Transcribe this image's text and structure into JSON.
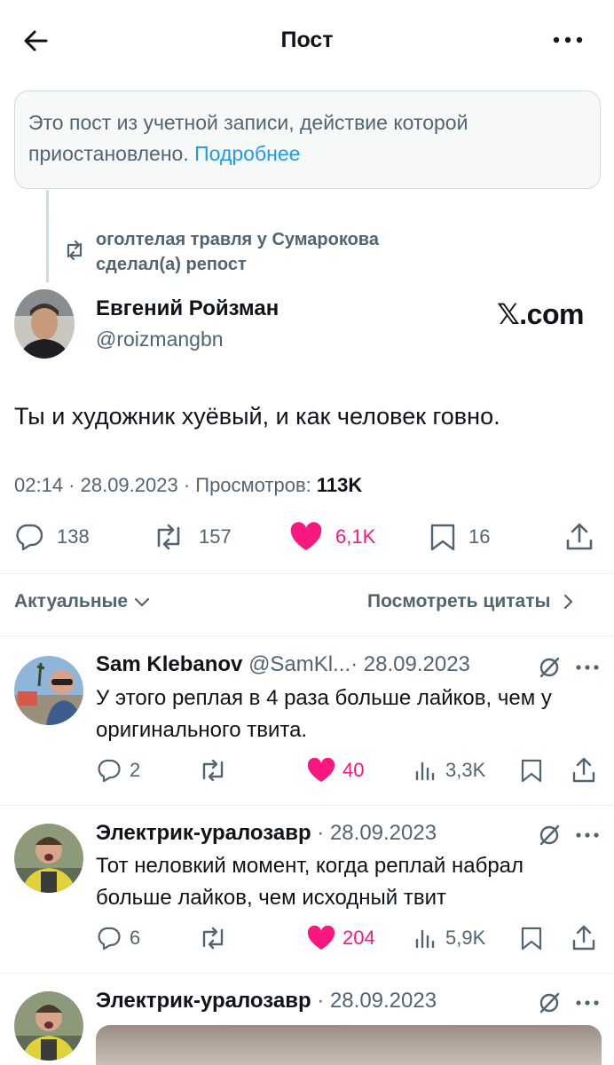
{
  "header": {
    "title": "Пост"
  },
  "notice": {
    "text": "Это пост из учетной записи, действие которой приостановлено.",
    "link": "Подробнее"
  },
  "repost": {
    "text": "оголтелая травля у Сумарокова сделал(а) репост"
  },
  "post": {
    "author_name": "Евгений Ройзман",
    "author_handle": "@roizmangbn",
    "watermark": "𝕏.com",
    "text": "Ты и художник хуёвый, и как человек говно.",
    "time": "02:14 · 28.09.2023 · Просмотров: ",
    "views": "113K",
    "replies": "138",
    "reposts": "157",
    "likes": "6,1K",
    "bookmarks": "16"
  },
  "bar": {
    "sort_label": "Актуальные",
    "quotes_label": "Посмотреть цитаты"
  },
  "replies": [
    {
      "name": "Sam Klebanov",
      "handle": "@SamKl...",
      "date": "· 28.09.2023",
      "text": "У этого реплая в 4 раза больше лайков, чем у оригинального твита.",
      "replies": "2",
      "reposts": "",
      "likes": "40",
      "views": "3,3K"
    },
    {
      "name": "Электрик-уралозавр",
      "handle": "",
      "date": "· 28.09.2023",
      "text": "Тот неловкий момент, когда реплай набрал больше лайков, чем исходный твит",
      "replies": "6",
      "reposts": "",
      "likes": "204",
      "views": "5,9K"
    },
    {
      "name": "Электрик-уралозавр",
      "handle": "",
      "date": "· 28.09.2023"
    }
  ],
  "colors": {
    "accent": "#1d9bf0",
    "like": "#f91880",
    "muted": "#536471",
    "text": "#0f1419"
  }
}
